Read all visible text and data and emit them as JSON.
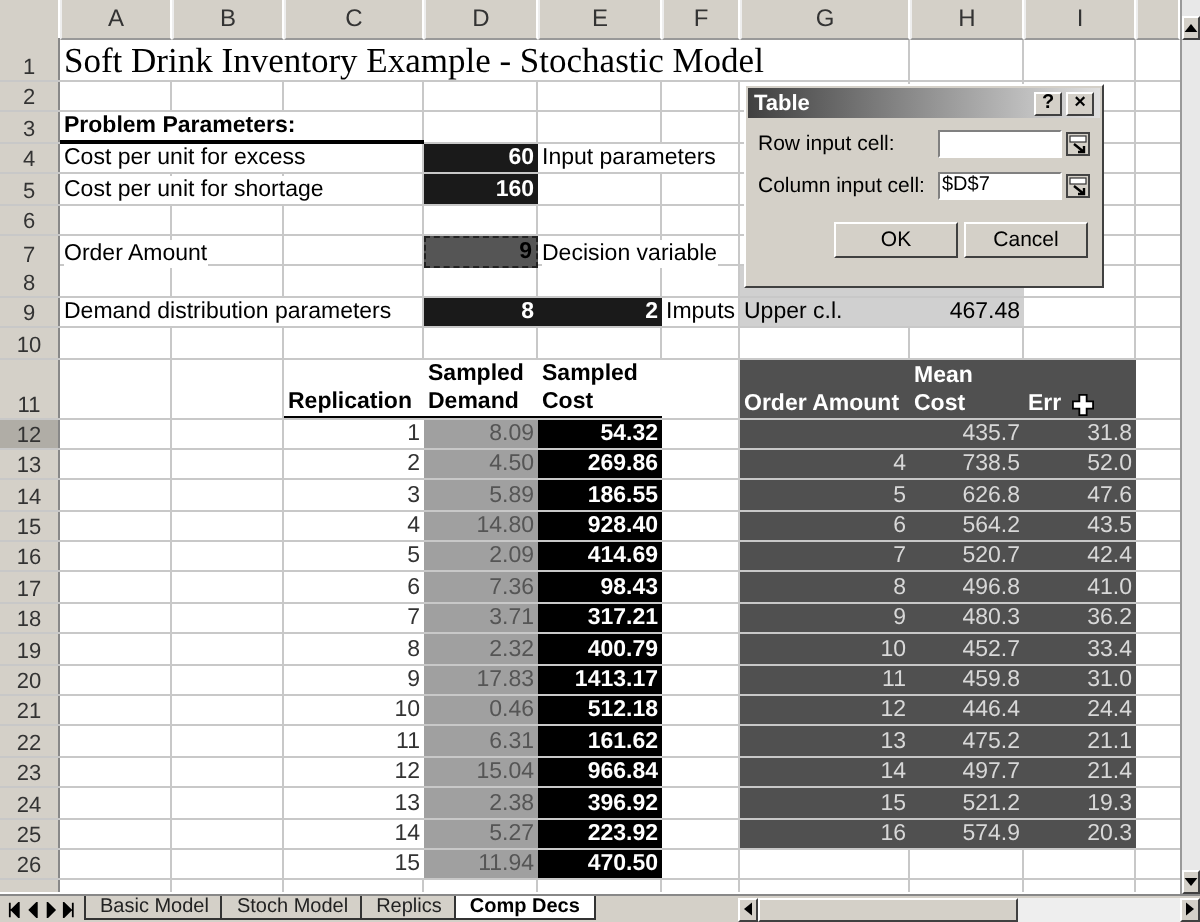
{
  "columns": [
    "A",
    "B",
    "C",
    "D",
    "E",
    "F",
    "G",
    "H",
    "I"
  ],
  "rows": [
    {
      "label": "1",
      "selected": false,
      "cells": [
        {
          "text": "Soft Drink Inventory Example - Stochastic Model",
          "kind": "title"
        },
        null,
        null,
        null,
        null,
        null,
        null,
        null,
        null
      ]
    },
    {
      "label": "2",
      "selected": false,
      "cells": [
        null,
        null,
        null,
        null,
        null,
        null,
        null,
        null,
        null
      ]
    },
    {
      "label": "3",
      "selected": false,
      "cells": [
        {
          "text": "Problem Parameters:",
          "kind": "section"
        },
        {
          "kind": "rule"
        },
        {
          "kind": "rule"
        },
        null,
        null,
        null,
        null,
        null,
        null
      ]
    },
    {
      "label": "4",
      "selected": false,
      "cells": [
        {
          "text": "Cost per unit for excess",
          "kind": "label"
        },
        null,
        null,
        {
          "text": "60",
          "kind": "input"
        },
        {
          "text": "Input parameters",
          "kind": "label"
        },
        null,
        null,
        null,
        null
      ]
    },
    {
      "label": "5",
      "selected": false,
      "cells": [
        {
          "text": "Cost per unit for shortage",
          "kind": "label"
        },
        null,
        null,
        {
          "text": "160",
          "kind": "input"
        },
        null,
        null,
        null,
        null,
        null
      ]
    },
    {
      "label": "6",
      "selected": false,
      "cells": [
        null,
        null,
        null,
        null,
        null,
        null,
        null,
        null,
        null
      ]
    },
    {
      "label": "7",
      "selected": false,
      "cells": [
        {
          "text": "Order Amount",
          "kind": "label"
        },
        null,
        null,
        {
          "text": "9",
          "kind": "decision"
        },
        {
          "text": "Decision variable",
          "kind": "label"
        },
        null,
        null,
        null,
        null
      ]
    },
    {
      "label": "8",
      "selected": false,
      "cells": [
        null,
        null,
        null,
        null,
        null,
        null,
        {
          "kind": "stat"
        },
        {
          "kind": "stat"
        },
        null
      ]
    },
    {
      "label": "9",
      "selected": false,
      "cells": [
        {
          "text": "Demand distribution parameters",
          "kind": "label"
        },
        null,
        null,
        {
          "text": "8",
          "kind": "input"
        },
        {
          "text": "2",
          "kind": "input"
        },
        {
          "text": "Imputs",
          "kind": "label"
        },
        {
          "text": "Upper c.l.",
          "kind": "stat-label"
        },
        {
          "text": "467.48",
          "kind": "stat"
        },
        null
      ]
    },
    {
      "label": "10",
      "selected": false,
      "cells": [
        null,
        null,
        null,
        null,
        null,
        null,
        null,
        null,
        null
      ]
    },
    {
      "label": "11",
      "selected": false,
      "cells": [
        null,
        null,
        {
          "text": "Replication",
          "kind": "header"
        },
        {
          "text": "Sampled\nDemand",
          "kind": "header"
        },
        {
          "text": "Sampled\nCost",
          "kind": "header"
        },
        null,
        {
          "text": "Order Amount",
          "kind": "table-header"
        },
        {
          "text": "Mean\nCost",
          "kind": "table-header"
        },
        {
          "text": "Err",
          "kind": "table-header"
        }
      ]
    },
    {
      "label": "12",
      "selected": true,
      "cells": [
        null,
        null,
        {
          "text": "1",
          "kind": "number"
        },
        {
          "text": "8.09",
          "kind": "demand"
        },
        {
          "text": "54.32",
          "kind": "cost"
        },
        null,
        {
          "kind": "table"
        },
        {
          "text": "435.7",
          "kind": "table"
        },
        {
          "text": "31.8",
          "kind": "table"
        }
      ]
    },
    {
      "label": "13",
      "selected": false,
      "cells": [
        null,
        null,
        {
          "text": "2",
          "kind": "number"
        },
        {
          "text": "4.50",
          "kind": "demand"
        },
        {
          "text": "269.86",
          "kind": "cost"
        },
        null,
        {
          "text": "4",
          "kind": "table"
        },
        {
          "text": "738.5",
          "kind": "table"
        },
        {
          "text": "52.0",
          "kind": "table"
        }
      ]
    },
    {
      "label": "14",
      "selected": false,
      "cells": [
        null,
        null,
        {
          "text": "3",
          "kind": "number"
        },
        {
          "text": "5.89",
          "kind": "demand"
        },
        {
          "text": "186.55",
          "kind": "cost"
        },
        null,
        {
          "text": "5",
          "kind": "table"
        },
        {
          "text": "626.8",
          "kind": "table"
        },
        {
          "text": "47.6",
          "kind": "table"
        }
      ]
    },
    {
      "label": "15",
      "selected": false,
      "cells": [
        null,
        null,
        {
          "text": "4",
          "kind": "number"
        },
        {
          "text": "14.80",
          "kind": "demand"
        },
        {
          "text": "928.40",
          "kind": "cost"
        },
        null,
        {
          "text": "6",
          "kind": "table"
        },
        {
          "text": "564.2",
          "kind": "table"
        },
        {
          "text": "43.5",
          "kind": "table"
        }
      ]
    },
    {
      "label": "16",
      "selected": false,
      "cells": [
        null,
        null,
        {
          "text": "5",
          "kind": "number"
        },
        {
          "text": "2.09",
          "kind": "demand"
        },
        {
          "text": "414.69",
          "kind": "cost"
        },
        null,
        {
          "text": "7",
          "kind": "table"
        },
        {
          "text": "520.7",
          "kind": "table"
        },
        {
          "text": "42.4",
          "kind": "table"
        }
      ]
    },
    {
      "label": "17",
      "selected": false,
      "cells": [
        null,
        null,
        {
          "text": "6",
          "kind": "number"
        },
        {
          "text": "7.36",
          "kind": "demand"
        },
        {
          "text": "98.43",
          "kind": "cost"
        },
        null,
        {
          "text": "8",
          "kind": "table"
        },
        {
          "text": "496.8",
          "kind": "table"
        },
        {
          "text": "41.0",
          "kind": "table"
        }
      ]
    },
    {
      "label": "18",
      "selected": false,
      "cells": [
        null,
        null,
        {
          "text": "7",
          "kind": "number"
        },
        {
          "text": "3.71",
          "kind": "demand"
        },
        {
          "text": "317.21",
          "kind": "cost"
        },
        null,
        {
          "text": "9",
          "kind": "table"
        },
        {
          "text": "480.3",
          "kind": "table"
        },
        {
          "text": "36.2",
          "kind": "table"
        }
      ]
    },
    {
      "label": "19",
      "selected": false,
      "cells": [
        null,
        null,
        {
          "text": "8",
          "kind": "number"
        },
        {
          "text": "2.32",
          "kind": "demand"
        },
        {
          "text": "400.79",
          "kind": "cost"
        },
        null,
        {
          "text": "10",
          "kind": "table"
        },
        {
          "text": "452.7",
          "kind": "table"
        },
        {
          "text": "33.4",
          "kind": "table"
        }
      ]
    },
    {
      "label": "20",
      "selected": false,
      "cells": [
        null,
        null,
        {
          "text": "9",
          "kind": "number"
        },
        {
          "text": "17.83",
          "kind": "demand"
        },
        {
          "text": "1413.17",
          "kind": "cost"
        },
        null,
        {
          "text": "11",
          "kind": "table"
        },
        {
          "text": "459.8",
          "kind": "table"
        },
        {
          "text": "31.0",
          "kind": "table"
        }
      ]
    },
    {
      "label": "21",
      "selected": false,
      "cells": [
        null,
        null,
        {
          "text": "10",
          "kind": "number"
        },
        {
          "text": "0.46",
          "kind": "demand"
        },
        {
          "text": "512.18",
          "kind": "cost"
        },
        null,
        {
          "text": "12",
          "kind": "table"
        },
        {
          "text": "446.4",
          "kind": "table"
        },
        {
          "text": "24.4",
          "kind": "table"
        }
      ]
    },
    {
      "label": "22",
      "selected": false,
      "cells": [
        null,
        null,
        {
          "text": "11",
          "kind": "number"
        },
        {
          "text": "6.31",
          "kind": "demand"
        },
        {
          "text": "161.62",
          "kind": "cost"
        },
        null,
        {
          "text": "13",
          "kind": "table"
        },
        {
          "text": "475.2",
          "kind": "table"
        },
        {
          "text": "21.1",
          "kind": "table"
        }
      ]
    },
    {
      "label": "23",
      "selected": false,
      "cells": [
        null,
        null,
        {
          "text": "12",
          "kind": "number"
        },
        {
          "text": "15.04",
          "kind": "demand"
        },
        {
          "text": "966.84",
          "kind": "cost"
        },
        null,
        {
          "text": "14",
          "kind": "table"
        },
        {
          "text": "497.7",
          "kind": "table"
        },
        {
          "text": "21.4",
          "kind": "table"
        }
      ]
    },
    {
      "label": "24",
      "selected": false,
      "cells": [
        null,
        null,
        {
          "text": "13",
          "kind": "number"
        },
        {
          "text": "2.38",
          "kind": "demand"
        },
        {
          "text": "396.92",
          "kind": "cost"
        },
        null,
        {
          "text": "15",
          "kind": "table"
        },
        {
          "text": "521.2",
          "kind": "table"
        },
        {
          "text": "19.3",
          "kind": "table"
        }
      ]
    },
    {
      "label": "25",
      "selected": false,
      "cells": [
        null,
        null,
        {
          "text": "14",
          "kind": "number"
        },
        {
          "text": "5.27",
          "kind": "demand"
        },
        {
          "text": "223.92",
          "kind": "cost"
        },
        null,
        {
          "text": "16",
          "kind": "table"
        },
        {
          "text": "574.9",
          "kind": "table"
        },
        {
          "text": "20.3",
          "kind": "table"
        }
      ]
    },
    {
      "label": "26",
      "selected": false,
      "cells": [
        null,
        null,
        {
          "text": "15",
          "kind": "number"
        },
        {
          "text": "11.94",
          "kind": "demand"
        },
        {
          "text": "470.50",
          "kind": "cost"
        },
        null,
        null,
        null,
        null
      ]
    }
  ],
  "dialog": {
    "title": "Table",
    "help": "?",
    "close": "×",
    "fields": [
      {
        "label": "Row input cell:"
      },
      {
        "label": "Column input cell:",
        "value": "$D$7"
      }
    ],
    "buttons": [
      "OK",
      "Cancel"
    ]
  },
  "sheet_tabs": [
    {
      "label": "Basic Model",
      "selected": false
    },
    {
      "label": "Stoch Model",
      "selected": false
    },
    {
      "label": "Replics",
      "selected": false
    },
    {
      "label": "Comp Decs",
      "selected": true
    }
  ]
}
